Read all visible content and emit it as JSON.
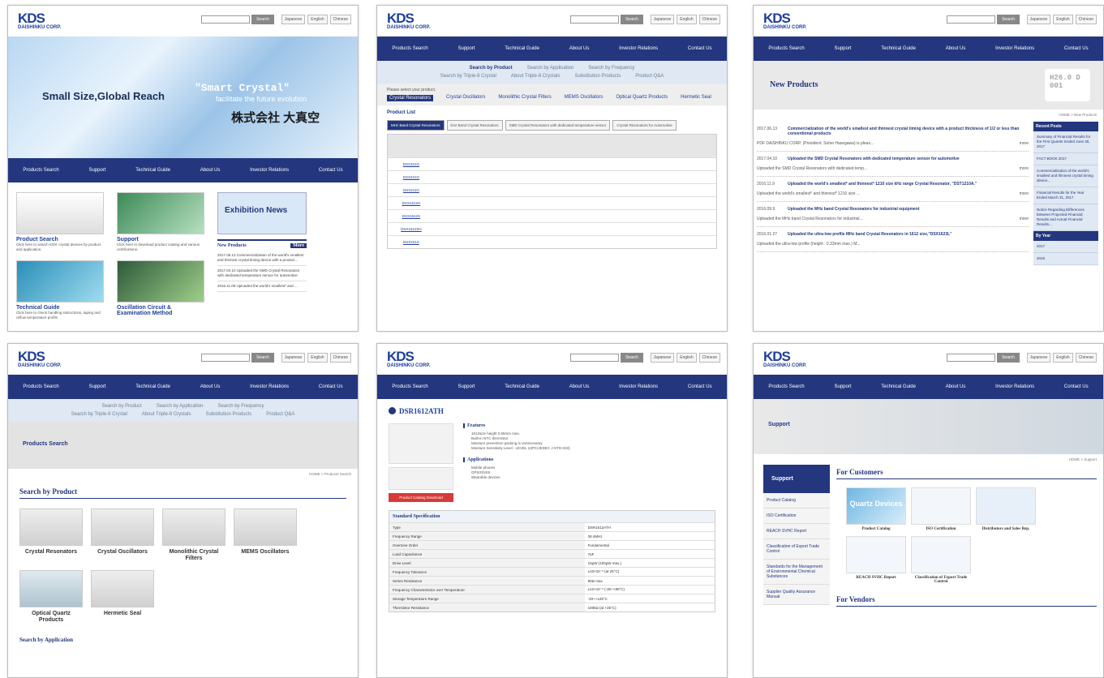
{
  "common": {
    "logo": "KDS",
    "logo_sub": "DAISHINKU CORP.",
    "search_btn": "Search",
    "langs": [
      "Japanese",
      "English",
      "Chinese"
    ],
    "nav": [
      "Products Search",
      "Support",
      "Technical Guide",
      "About Us",
      "Investor Relations",
      "Contact Us"
    ],
    "subnav_row1": [
      "Search by Product",
      "Search by Application",
      "Search by Frequency"
    ],
    "subnav_row2": [
      "Search by Triple-8 Crystal",
      "About Triple-8 Crystals",
      "Substitution Products",
      "Product Q&A"
    ]
  },
  "home": {
    "tagline": "Small Size,Global Reach",
    "smart": "\"Smart Crystal\"",
    "smart_sub": "facilitate the future evolution",
    "company_jp": "株式会社 大真空",
    "tiles": [
      {
        "title": "Product Search",
        "desc": "Click here to search KDS' crystal devices by product and application."
      },
      {
        "title": "Support",
        "desc": "Click here to download product catalog and various certifications."
      },
      {
        "title": "Technical Guide",
        "desc": "Click here to check handling instructions, taping and reflow temperature profile."
      },
      {
        "title": "Oscillation Circuit & Examination Method",
        "desc": ""
      }
    ],
    "exhibition": "Exhibition News",
    "new_products": "New Products",
    "more": "More",
    "news": [
      "2017.06.13 Commercialization of the world's smallest and thinnest crystal timing device with a product...",
      "2017.04.10 Uploaded the SMD Crystal Resonators with dedicated temperature sensor for automotive",
      "2016.11.09 Uploaded the world's smallest* and ..."
    ]
  },
  "productlist": {
    "prompt": "Please select your product.",
    "categories": [
      "Crystal Resonators",
      "Crystal Oscillators",
      "Monolithic Crystal Filters",
      "MEMS Oscillators",
      "Optical Quartz Products",
      "Hermetic Seal"
    ],
    "list_title": "Product List",
    "tabs": [
      "MHz Band Crystal Resonators",
      "kHz Band Crystal Resonators",
      "SMD Crystal Resonators with dedicated temperature sensor",
      "Crystal Resonators for Automotive"
    ],
    "models": [
      "DSX321G",
      "DSX221G",
      "DSX211G",
      "DSX211SH",
      "DSX1612S",
      "DSX1612SH",
      "DSX221S"
    ]
  },
  "news": {
    "title": "New Products",
    "stamp": "H26.0 D 001",
    "breadcrumb": "HOME > New Products",
    "more": "more",
    "items": [
      {
        "date": "2017.06.13",
        "head": "Commercialization of the world's smallest and thinnest crystal timing device with a product thickness of 1/2 or less than conventional products",
        "text": "PDF DAISHINKU CORP. (President: Sohei Hasegawa) is pleas..."
      },
      {
        "date": "2017.04.10",
        "head": "Uploaded the SMD Crystal Resonators with dedicated temperature sensor for automotive",
        "text": "Uploaded the SMD Crystal Resonators with dedicated temp..."
      },
      {
        "date": "2016.11.9",
        "head": "Uploaded the world's smallest* and thinnest* 1210 size kHz range Crystal Resonator, \"DST1210A.\"",
        "text": "Uploaded the world's smallest* and thinnest* 1210 size ..."
      },
      {
        "date": "2016.09.9",
        "head": "Uploaded the MHz band Crystal Resonators for industrial equipment",
        "text": "Uploaded the MHz band Crystal Resonators for industrial..."
      },
      {
        "date": "2016.01.27",
        "head": "Uploaded the ultra-low profile MHz band Crystal Resonators in 1612 size,\"DSX1623L\"",
        "text": "Uploaded the ultra-low profile (height : 0.33mm max.) M..."
      }
    ],
    "recent_title": "Recent Posts",
    "recent": [
      "Summary of Financial Results for the First Quarter Ended June 30, 2017",
      "FACT BOOK 2017",
      "Commercialization of the world's smallest and thinnest crystal timing device...",
      "Financial Results for the Year Ended March 31, 2017",
      "Notice Regarding Differences between Projected Financial Results and Actual Financial Results..."
    ],
    "by_year": "By Year",
    "years": [
      "2017",
      "2016"
    ]
  },
  "prodsearch": {
    "section": "Products Search",
    "breadcrumb": "HOME > Products Search",
    "title": "Search by Product",
    "products": [
      "Crystal Resonators",
      "Crystal Oscillators",
      "Monolithic Crystal Filters",
      "MEMS Oscillators",
      "Optical Quartz Products",
      "Hermetic Seal"
    ],
    "next": "Search by Application"
  },
  "detail": {
    "model": "DSR1612ATH",
    "features_title": "Features",
    "features": [
      "1612size height 0.65mm max.",
      "Built-in NTC thermistor",
      "Moisture prevention packing is unnecessary.",
      "Moisture Sensitivity Level : LEVEL 1(IPC/JEDEC J-STD-033)"
    ],
    "apps_title": "Applications",
    "apps": [
      "Mobile phones",
      "GPS/GNSS",
      "Wearable devices"
    ],
    "download": "Product Catalog Download",
    "spec_title": "Standard Specification",
    "spec": [
      [
        "Type",
        "DSR1612ATH"
      ],
      [
        "Frequency Range",
        "38.4MHz"
      ],
      [
        "Overtone Order",
        "Fundamental"
      ],
      [
        "Load Capacitance",
        "7pF"
      ],
      [
        "Drive Level",
        "10μW (100μW max.)"
      ],
      [
        "Frequency Tolerance",
        "±10×10⁻⁶ (at 25°C)"
      ],
      [
        "Series Resistance",
        "80Ω max"
      ],
      [
        "Frequency Characteristics over Temperature",
        "±12×10⁻⁶ (-30~+85°C)"
      ],
      [
        "Storage Temperature Range",
        "-40~+125°C"
      ],
      [
        "Thermistor Resistance",
        "100kΩ (at +25°C)"
      ]
    ]
  },
  "support": {
    "section": "Support",
    "breadcrumb": "HOME > Support",
    "side_title": "Support",
    "side": [
      "Product Catalog",
      "ISO Certification",
      "REACH SVHC Report",
      "Classification of Export Trade Control",
      "Standards for the Management of Environmental Chemical Substances",
      "Supplier Quality Assurance Manual"
    ],
    "for_customers": "For Customers",
    "items": [
      "Product Catalog",
      "ISO Certification",
      "Distributors and Sales Rep.",
      "REACH SVHC Report",
      "Classification of Export Trade Control"
    ],
    "for_vendors": "For Vendors",
    "quartz": "Quartz Devices"
  }
}
